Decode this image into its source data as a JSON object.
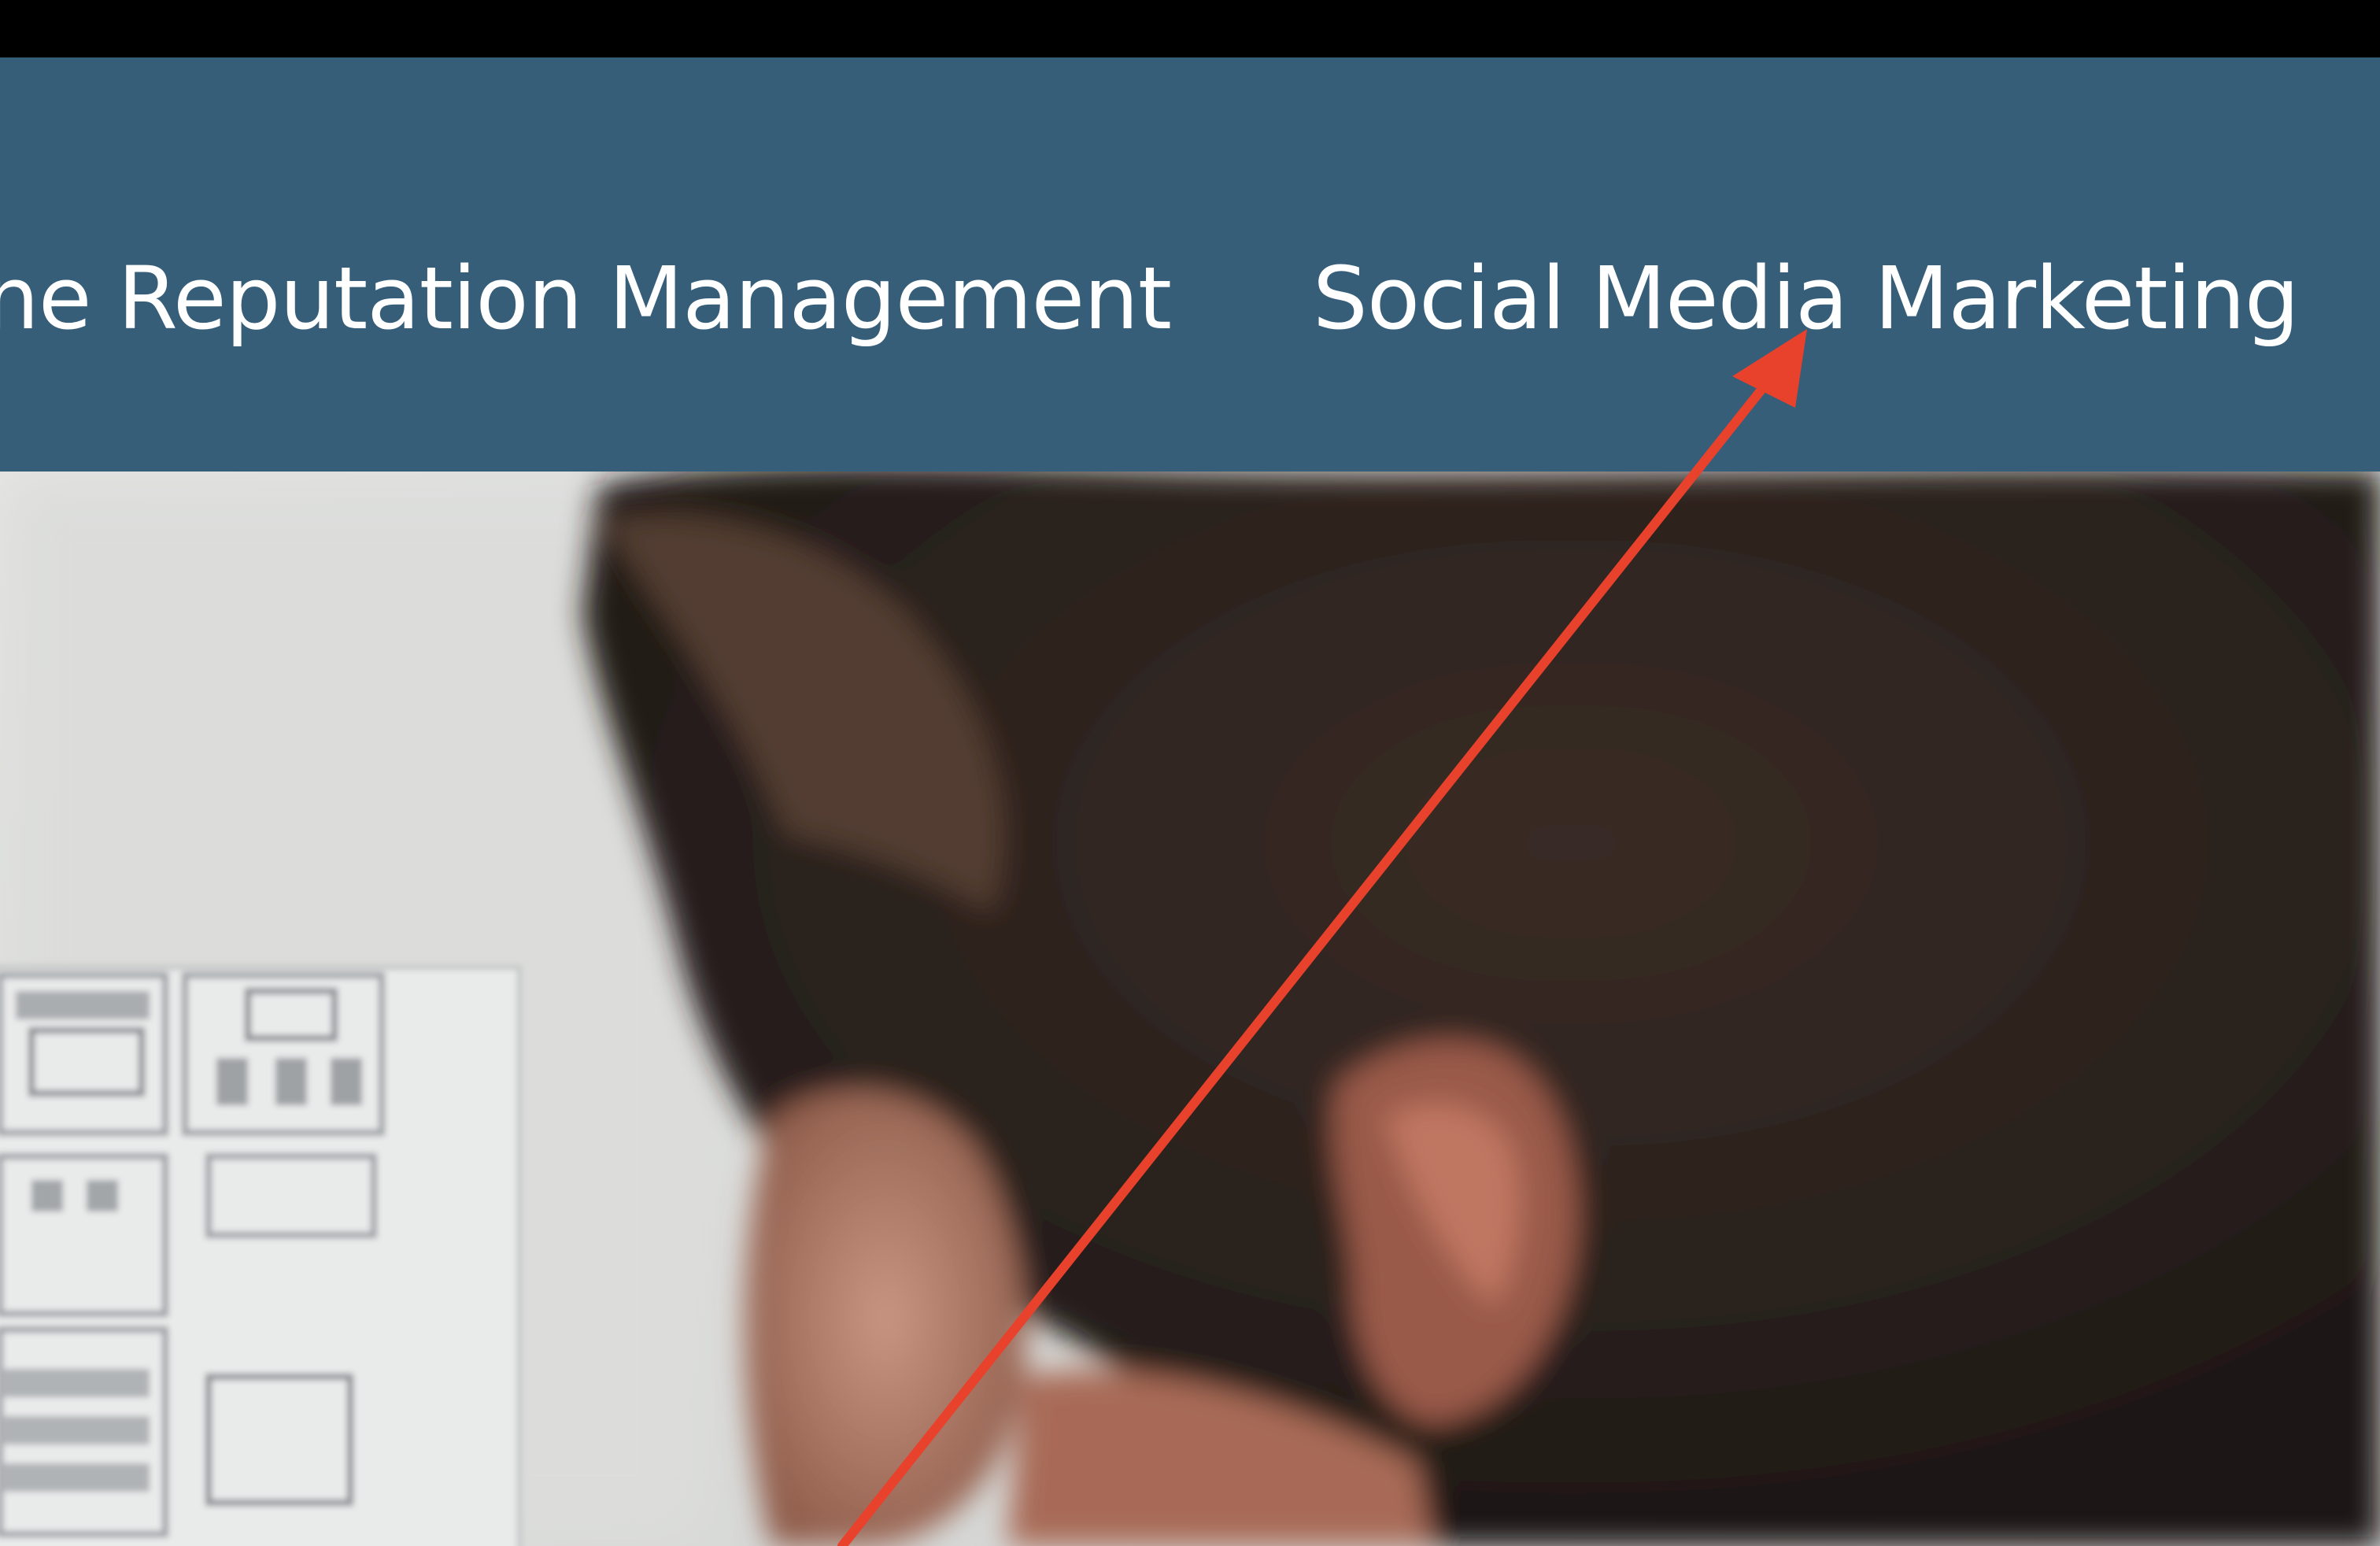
{
  "nav": {
    "links": [
      {
        "label": "Online Reputation Management"
      },
      {
        "label": "Social Media Marketing"
      }
    ]
  },
  "colors": {
    "nav_background": "#365e79",
    "nav_text": "#ffffff",
    "annotation_arrow": "#e8412c",
    "top_border": "#000000"
  },
  "annotation": {
    "type": "arrow",
    "points_to": "Social Media Marketing"
  },
  "hero": {
    "image_description_icon": "person-with-wireframe-sketches-photo"
  }
}
